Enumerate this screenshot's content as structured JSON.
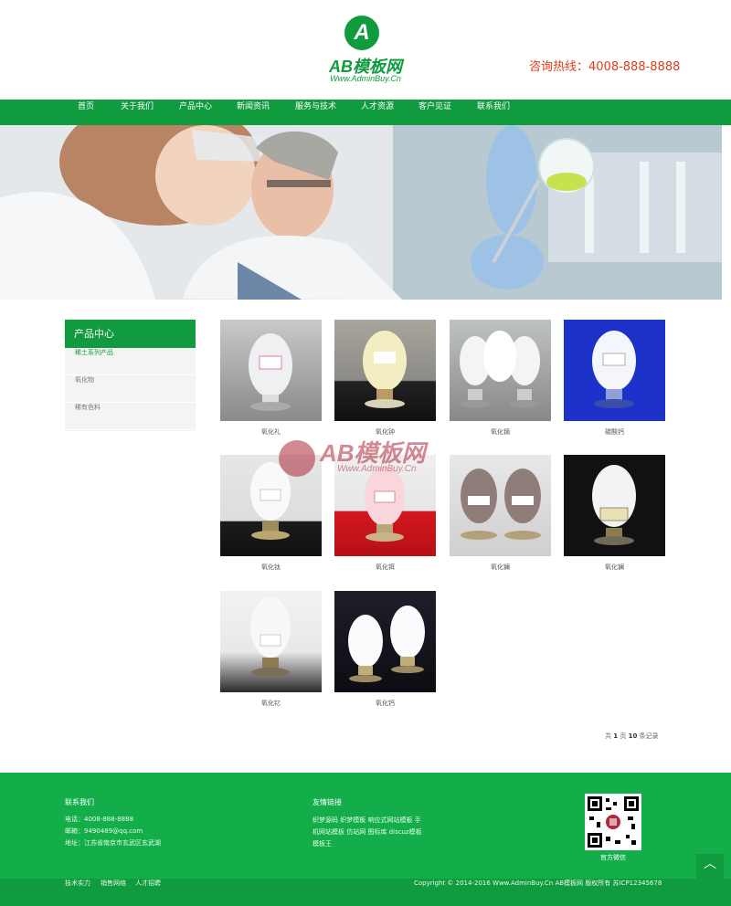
{
  "header": {
    "logo_glyph": "A",
    "logo_text": "AB模板网",
    "logo_sub": "Www.AdminBuy.Cn",
    "hotline": "咨询热线：4008-888-8888"
  },
  "nav": {
    "items": [
      "首页",
      "关于我们",
      "产品中心",
      "新闻资讯",
      "服务与技术",
      "人才资源",
      "客户见证",
      "联系我们"
    ]
  },
  "sidebar": {
    "title": "产品中心",
    "items": [
      "稀土系列产品",
      "氧化物",
      "稀有色料"
    ]
  },
  "products": [
    {
      "name": "氧化礼"
    },
    {
      "name": "氧化钟"
    },
    {
      "name": "氧化镝"
    },
    {
      "name": "碳酸钙"
    },
    {
      "name": "氧化钛"
    },
    {
      "name": "氧化铒"
    },
    {
      "name": "氧化镧"
    },
    {
      "name": "氧化镧"
    },
    {
      "name": "氧化钇"
    },
    {
      "name": "氧化钙"
    }
  ],
  "pager": {
    "prefix": "共",
    "pages": "1",
    "mid": "页",
    "count": "10",
    "suffix": "条记录"
  },
  "watermark": {
    "text": "AB模板网",
    "sub": "Www.AdminBuy.Cn"
  },
  "footer": {
    "contact_title": "联系我们",
    "phone": "电话：4008-888-8888",
    "email": "邮箱：9490489@qq.com",
    "address": "地址：江苏省南京市玄武区玄武湖",
    "links_title": "友情链接",
    "links": "织梦源码 织梦模板 响应式网站模板 手机网站模板 仿站网 图标库 discuz模板 模板王",
    "qr_caption": "官方微信",
    "bottom_links": [
      "技术实力",
      "销售网络",
      "人才招聘"
    ],
    "copyright": "Copyright © 2014-2016 Www.AdminBuy.Cn AB模板网 版权所有   苏ICP12345678"
  },
  "to_top": "︿",
  "colors": {
    "brand_green": "#0f9b3e",
    "footer_green": "#13ae4a",
    "hotline_red": "#e53a1b"
  }
}
